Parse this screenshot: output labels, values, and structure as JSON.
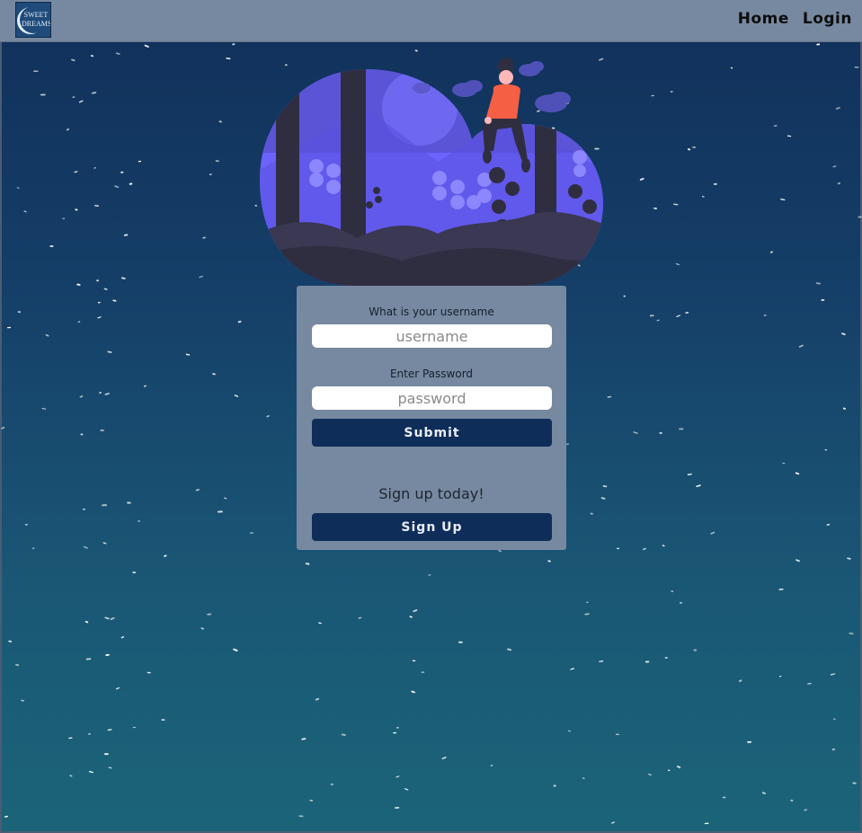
{
  "navbar": {
    "logo_text_line1": "SWEET",
    "logo_text_line2": "DREAMS",
    "links": [
      {
        "label": "Home"
      },
      {
        "label": "Login"
      }
    ]
  },
  "form": {
    "username_label": "What is your username",
    "username_placeholder": "username",
    "password_label": "Enter Password",
    "password_placeholder": "password",
    "submit_label": "Submit",
    "signup_prompt": "Sign up today!",
    "signup_label": "Sign Up"
  },
  "colors": {
    "navbar": "#7789a0",
    "button": "#0f2d59",
    "background_top": "#10305a",
    "background_bottom": "#1b6478",
    "illustration_accent": "#6c63ff",
    "illustration_dark": "#2f2e41",
    "person_shirt": "#f55f44"
  },
  "icons": {
    "logo": "moon-logo-icon",
    "illustration": "night-forest-girl-illustration"
  }
}
